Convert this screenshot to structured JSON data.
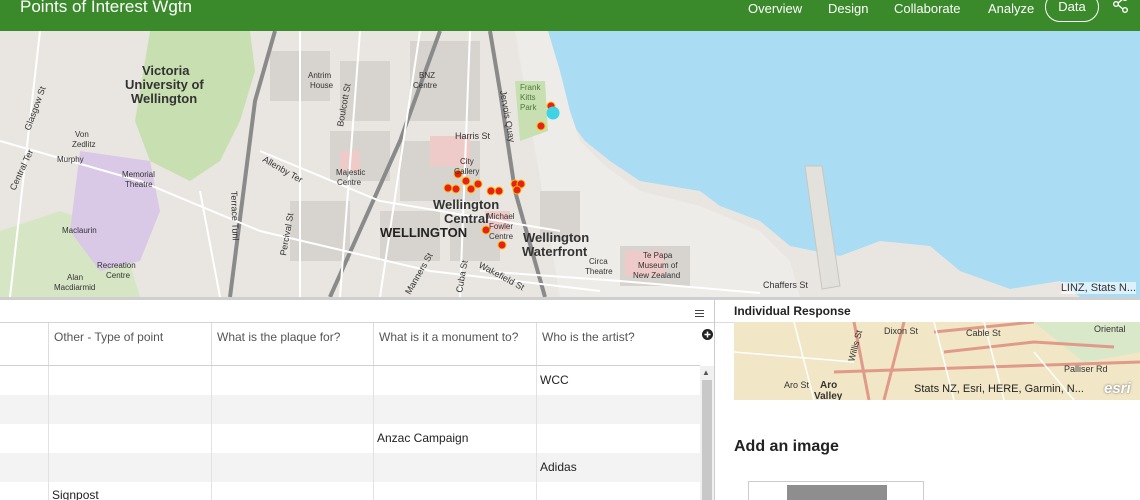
{
  "header": {
    "title": "Points of Interest Wgtn",
    "nav": [
      "Overview",
      "Design",
      "Collaborate",
      "Analyze"
    ],
    "data_button": "Data",
    "share_icon": "share-icon"
  },
  "map": {
    "labels": {
      "victoria": "Victoria",
      "university_of": "University of",
      "wellington_uni": "Wellington",
      "antrim": "Antrim",
      "house": "House",
      "bnz": "BNZ",
      "centre_bnz": "Centre",
      "frank": "Frank",
      "kitts": "Kitts",
      "park": "Park",
      "harris_st": "Harris St",
      "boulcott_st": "Boulcott St",
      "jervois_quay": "Jervois Quay",
      "von": "Von",
      "zedlitz": "Zedlitz",
      "murphy": "Murphy",
      "memorial": "Memorial",
      "theatre": "Theatre",
      "central_ter": "Central Ter",
      "glasgow_st": "Glasgow St",
      "allenby_ter": "Allenby Ter",
      "majestic": "Majestic",
      "centre_majestic": "Centre",
      "city": "City",
      "gallery": "Gallery",
      "wellington_central_1": "Wellington",
      "wellington_central_2": "Central",
      "wellington_caps": "WELLINGTON",
      "michael": "Michael",
      "fowler": "Fowler",
      "centre_fowler": "Centre",
      "wellington_waterfront_1": "Wellington",
      "wellington_waterfront_2": "Waterfront",
      "terrace_tunl": "Terrace Tunl",
      "percival_st": "Percival St",
      "maclaurin": "Maclaurin",
      "recreation": "Recreation",
      "centre_rec": "Centre",
      "alan": "Alan",
      "macdiarmid": "Macdiarmid",
      "circa": "Circa",
      "theatre_circa": "Theatre",
      "te_papa": "Te Papa",
      "museum_of": "Museum of",
      "new_zealand": "New Zealand",
      "wakefield_st": "Wakefield St",
      "chaffers_st": "Chaffers St",
      "cuba_st": "Cuba St",
      "manners_st": "Manners St"
    },
    "attribution": "LINZ, Stats N...",
    "point_color": "#e8201c",
    "selected_color": "#3fd3e6",
    "water_color": "#aadcf3"
  },
  "table": {
    "columns": [
      "Other - Type of point",
      "What is the plaque for?",
      "What is it a monument to?",
      "Who is the artist?"
    ],
    "rows": [
      [
        "",
        "",
        "",
        "WCC"
      ],
      [
        "",
        "",
        "",
        ""
      ],
      [
        "",
        "",
        "Anzac Campaign",
        ""
      ],
      [
        "",
        "",
        "",
        "Adidas"
      ],
      [
        "Signpost",
        "",
        "",
        ""
      ]
    ]
  },
  "detail": {
    "title": "Individual Response",
    "minimap": {
      "street_labels": [
        "Cable St",
        "Dixon St",
        "Willis St",
        "Oriental",
        "Palliser Rd",
        "Aro St",
        "Aro",
        "Valley"
      ],
      "attribution": "Stats NZ, Esri, HERE, Garmin, N...",
      "logo": "esri"
    },
    "add_image_label": "Add an image"
  }
}
